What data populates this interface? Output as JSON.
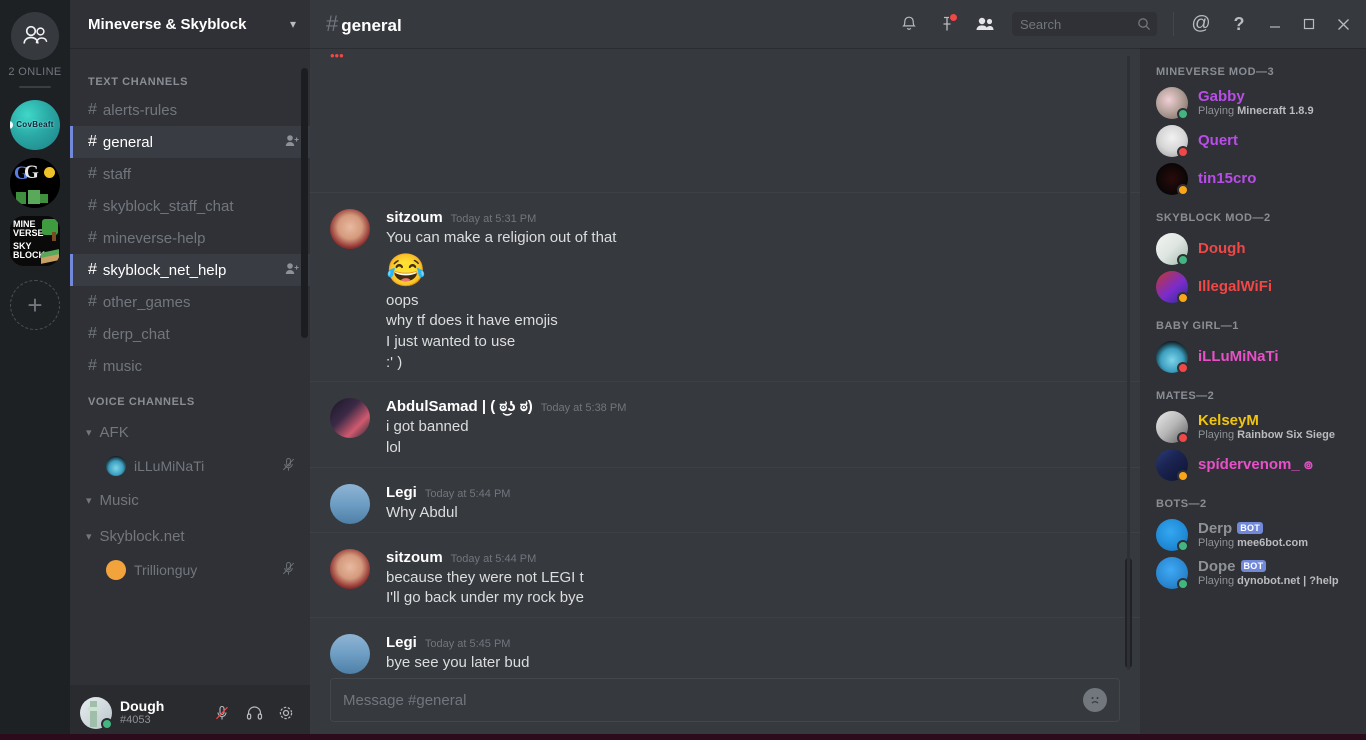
{
  "rail": {
    "home_icon": "friends-icon",
    "online_label": "2 ONLINE",
    "guilds": [
      {
        "name": "CovBeaft",
        "label": "CovBeaft"
      },
      {
        "name": "G-server",
        "label": "G"
      },
      {
        "name": "Mineverse & Skyblock",
        "label": "MINE VERSE SKY BLOCK"
      }
    ],
    "add_label": "+"
  },
  "sidebar": {
    "guild_name": "Mineverse & Skyblock",
    "chevron": "chevron-down",
    "text_header": "TEXT CHANNELS",
    "text_channels": [
      {
        "name": "alerts-rules",
        "active": false
      },
      {
        "name": "general",
        "active": true
      },
      {
        "name": "staff",
        "active": false
      },
      {
        "name": "skyblock_staff_chat",
        "active": false
      },
      {
        "name": "mineverse-help",
        "active": false
      },
      {
        "name": "skyblock_net_help",
        "active": true
      },
      {
        "name": "other_games",
        "active": false
      },
      {
        "name": "derp_chat",
        "active": false
      },
      {
        "name": "music",
        "active": false
      }
    ],
    "voice_header": "VOICE CHANNELS",
    "voice_channels": [
      {
        "name": "AFK",
        "users": [
          {
            "name": "iLLuMiNaTi",
            "avatar": "a-illumi"
          }
        ]
      },
      {
        "name": "Music",
        "users": []
      },
      {
        "name": "Skyblock.net",
        "users": [
          {
            "name": "Trillionguy",
            "avatar": "a-trillion"
          }
        ]
      }
    ]
  },
  "user_panel": {
    "name": "Dough",
    "tag": "#4053",
    "mute_icon": "mic-muted-icon",
    "deafen_icon": "headphones-icon",
    "settings_icon": "gear-icon"
  },
  "topbar": {
    "hash": "#",
    "channel": "general",
    "icons": [
      {
        "name": "bell-icon",
        "badge": false
      },
      {
        "name": "pin-icon",
        "badge": true
      },
      {
        "name": "members-icon",
        "badge": false
      }
    ],
    "search_placeholder": "Search",
    "search_icon": "search-icon",
    "mentions_icon": "at-icon",
    "help_icon": "question-icon",
    "minimize": "minimize-icon",
    "maximize": "maximize-icon",
    "close": "close-icon"
  },
  "messages": [
    {
      "author": "sitzoum",
      "avatar": "a-sitz",
      "timestamp": "Today at 5:31 PM",
      "divider": true,
      "lines": [
        "You can make a religion out of that"
      ],
      "emoji": "😂",
      "lines_after": [
        "oops",
        "why tf does it have emojis",
        "I just wanted to use",
        ":' )"
      ]
    },
    {
      "author": "AbdulSamad | ( ಠ͜ʖ ಠ)",
      "avatar": "a-abdul",
      "timestamp": "Today at 5:38 PM",
      "divider": true,
      "lines": [
        "i got banned",
        "lol"
      ]
    },
    {
      "author": "Legi",
      "avatar": "a-legi",
      "timestamp": "Today at 5:44 PM",
      "divider": true,
      "lines": [
        "Why Abdul"
      ]
    },
    {
      "author": "sitzoum",
      "avatar": "a-sitz",
      "timestamp": "Today at 5:44 PM",
      "divider": true,
      "lines": [
        "because they were not LEGI t",
        "I'll go back under my rock bye"
      ]
    },
    {
      "author": "Legi",
      "avatar": "a-legi",
      "timestamp": "Today at 5:45 PM",
      "divider": true,
      "lines": [
        "bye see you later bud"
      ]
    }
  ],
  "composer": {
    "placeholder": "Message #general",
    "emoji_icon": "emoji-icon"
  },
  "members": {
    "groups": [
      {
        "title": "MINEVERSE MOD—3",
        "people": [
          {
            "name": "Gabby",
            "color": "#b94de8",
            "status": "#43b581",
            "activity_prefix": "Playing ",
            "activity": "Minecraft 1.8.9",
            "avatar": "a-gabby",
            "bot": false
          },
          {
            "name": "Quert",
            "color": "#b94de8",
            "status": "#f04747",
            "activity_prefix": "",
            "activity": "",
            "avatar": "a-quert",
            "bot": false
          },
          {
            "name": "tin15cro",
            "color": "#b94de8",
            "status": "#faa61a",
            "activity_prefix": "",
            "activity": "",
            "avatar": "a-tin",
            "bot": false
          }
        ]
      },
      {
        "title": "SKYBLOCK MOD—2",
        "people": [
          {
            "name": "Dough",
            "color": "#f04747",
            "status": "#43b581",
            "activity_prefix": "",
            "activity": "",
            "avatar": "a-dough",
            "bot": false
          },
          {
            "name": "IllegalWiFi",
            "color": "#f04747",
            "status": "#faa61a",
            "activity_prefix": "",
            "activity": "",
            "avatar": "a-illegal",
            "bot": false
          }
        ]
      },
      {
        "title": "BABY GIRL—1",
        "people": [
          {
            "name": "iLLuMiNaTi",
            "color": "#e850c8",
            "status": "#f04747",
            "activity_prefix": "",
            "activity": "",
            "avatar": "a-illumi",
            "bot": false
          }
        ]
      },
      {
        "title": "MATES—2",
        "people": [
          {
            "name": "KelseyM",
            "color": "#f1c40f",
            "status": "#f04747",
            "activity_prefix": "Playing ",
            "activity": "Rainbow Six Siege",
            "avatar": "a-kelsey",
            "bot": false
          },
          {
            "name": "spídervenom_ ๏",
            "color": "#e850c8",
            "status": "#faa61a",
            "activity_prefix": "",
            "activity": "",
            "avatar": "a-spider",
            "bot": false
          }
        ]
      },
      {
        "title": "BOTS—2",
        "people": [
          {
            "name": "Derp",
            "color": "#8e9297",
            "status": "#43b581",
            "activity_prefix": "Playing ",
            "activity": "mee6bot.com",
            "avatar": "a-derp",
            "bot": true,
            "bot_label": "BOT"
          },
          {
            "name": "Dope",
            "color": "#8e9297",
            "status": "#43b581",
            "activity_prefix": "Playing ",
            "activity": "dynobot.net | ?help",
            "avatar": "a-dope",
            "bot": true,
            "bot_label": "BOT"
          }
        ]
      }
    ]
  },
  "colors": {
    "rail_bg": "#1e2124",
    "sidebar_bg": "#2f3136",
    "main_bg": "#36393e",
    "accent": "#7289da",
    "online": "#43b581",
    "idle": "#faa61a",
    "dnd": "#f04747",
    "text": "#dcddde",
    "muted": "#72767d"
  }
}
